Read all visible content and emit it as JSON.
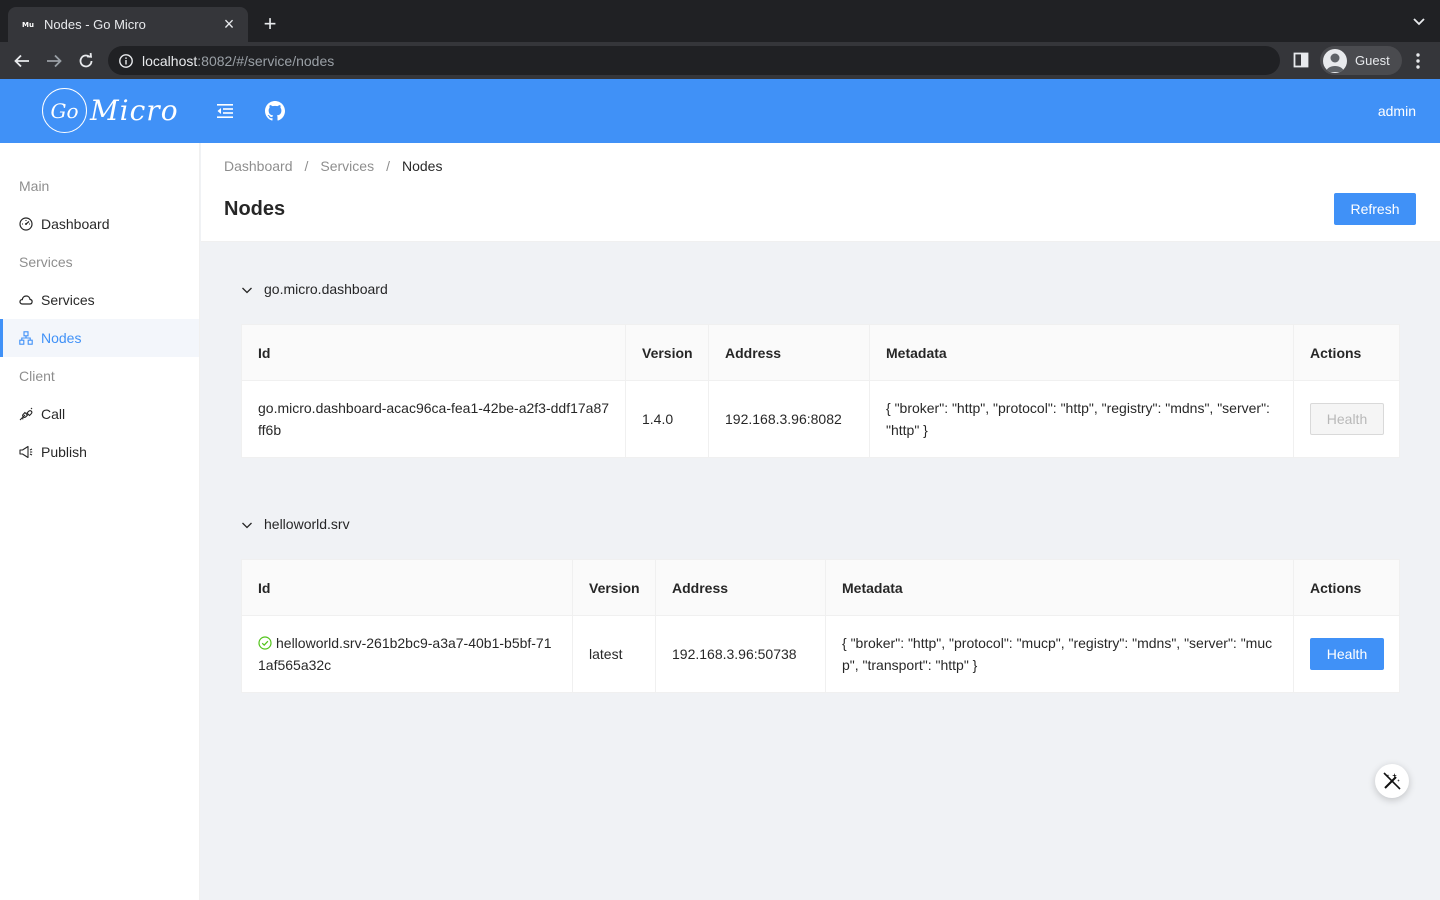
{
  "browser": {
    "tab_title": "Nodes - Go Micro",
    "favicon_text": "Mu",
    "close_glyph": "×",
    "new_tab_glyph": "+",
    "url_host": "localhost",
    "url_path": ":8082/#/service/nodes",
    "profile_name": "Guest"
  },
  "header": {
    "logo_mark": "Go",
    "logo_text": "Micro",
    "user": "admin"
  },
  "sidebar": {
    "groups": [
      {
        "label": "Main",
        "items": [
          {
            "label": "Dashboard",
            "icon": "dashboard-icon"
          }
        ]
      },
      {
        "label": "Services",
        "items": [
          {
            "label": "Services",
            "icon": "cloud-icon"
          },
          {
            "label": "Nodes",
            "icon": "cluster-icon",
            "active": true
          }
        ]
      },
      {
        "label": "Client",
        "items": [
          {
            "label": "Call",
            "icon": "api-icon"
          },
          {
            "label": "Publish",
            "icon": "sound-icon"
          }
        ]
      }
    ]
  },
  "page": {
    "breadcrumb": [
      "Dashboard",
      "Services",
      "Nodes"
    ],
    "breadcrumb_separator": "/",
    "title": "Nodes",
    "refresh_label": "Refresh"
  },
  "columns": [
    "Id",
    "Version",
    "Address",
    "Metadata",
    "Actions"
  ],
  "services": [
    {
      "name": "go.micro.dashboard",
      "nodes": [
        {
          "id": "go.micro.dashboard-acac96ca-fea1-42be-a2f3-ddf17a87ff6b",
          "version": "1.4.0",
          "address": "192.168.3.96:8082",
          "metadata": "{ \"broker\": \"http\", \"protocol\": \"http\", \"registry\": \"mdns\", \"server\": \"http\" }",
          "action": "Health",
          "action_enabled": false,
          "healthy": false
        }
      ]
    },
    {
      "name": "helloworld.srv",
      "nodes": [
        {
          "id": "helloworld.srv-261b2bc9-a3a7-40b1-b5bf-711af565a32c",
          "version": "latest",
          "address": "192.168.3.96:50738",
          "metadata": "{ \"broker\": \"http\", \"protocol\": \"mucp\", \"registry\": \"mdns\", \"server\": \"mucp\", \"transport\": \"http\" }",
          "action": "Health",
          "action_enabled": true,
          "healthy": true
        }
      ]
    }
  ],
  "colors": {
    "primary": "#4091f7",
    "success": "#52c41a"
  }
}
